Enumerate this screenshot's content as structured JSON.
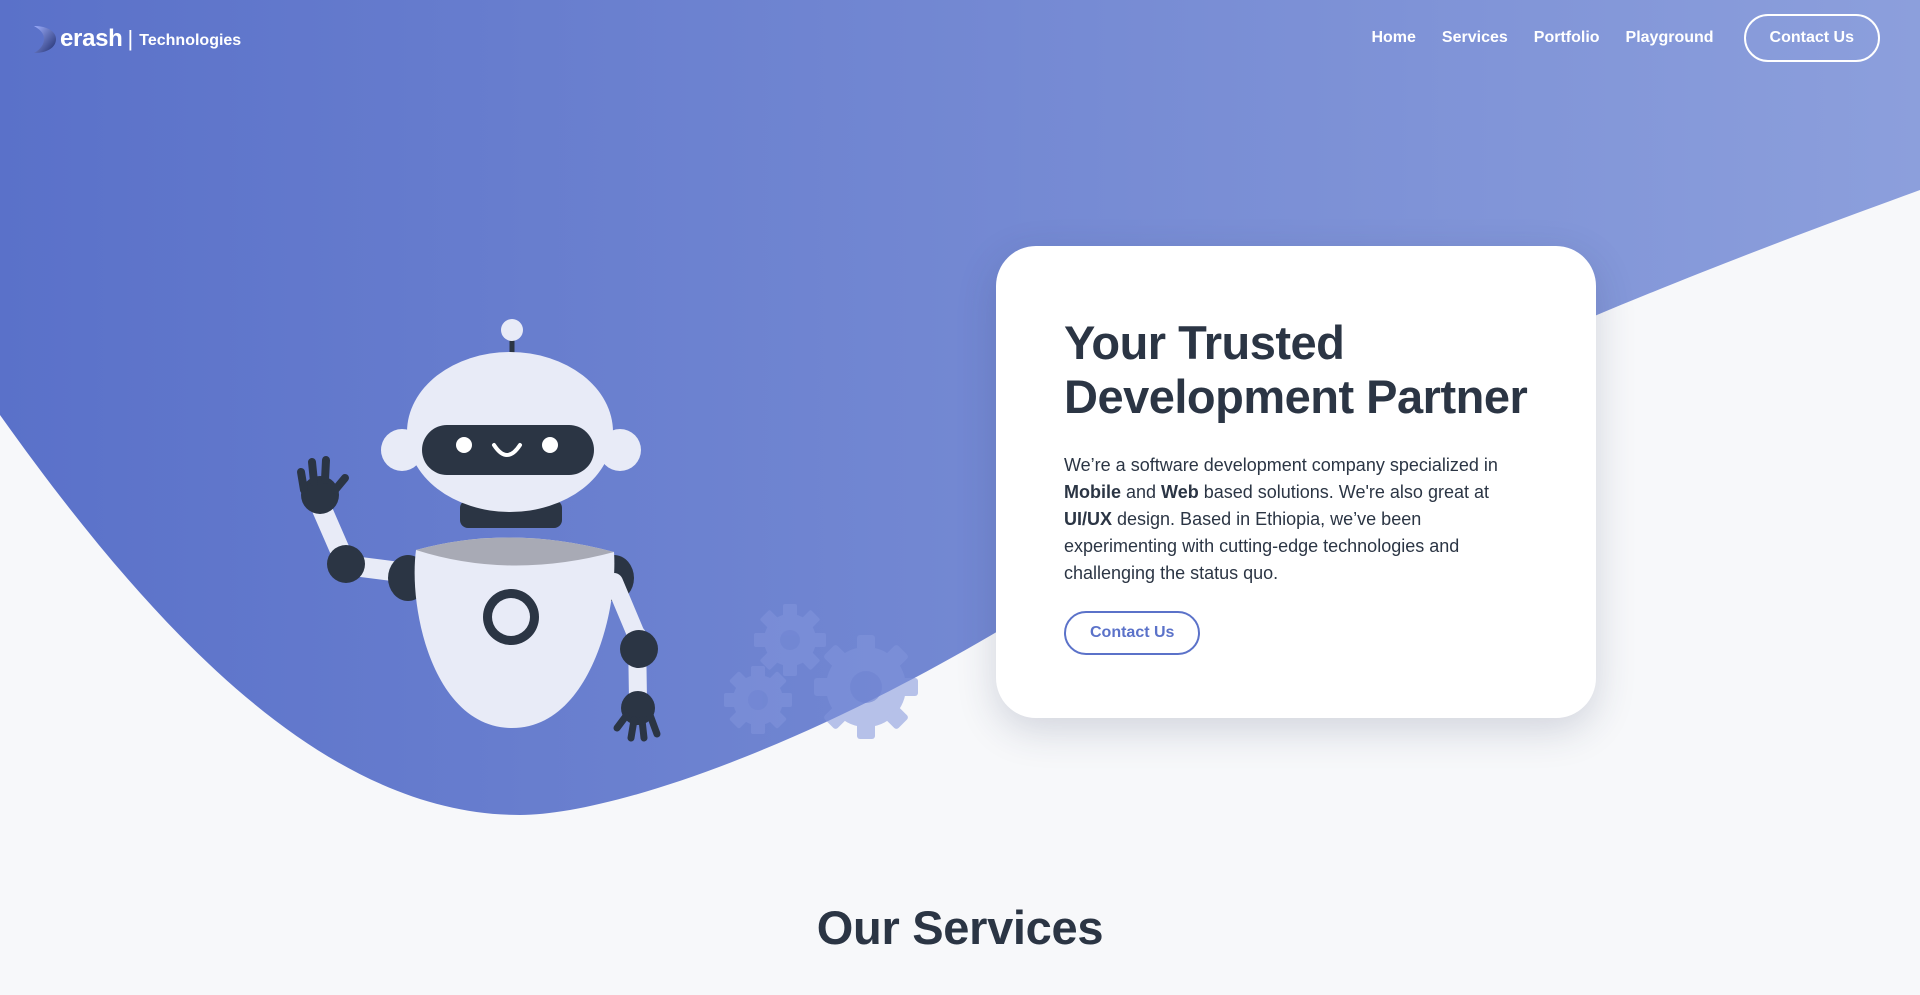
{
  "brand": {
    "name": "erash",
    "separator": "|",
    "tagline": "Technologies"
  },
  "nav": {
    "items": [
      {
        "label": "Home"
      },
      {
        "label": "Services"
      },
      {
        "label": "Portfolio"
      },
      {
        "label": "Playground"
      }
    ],
    "cta_label": "Contact Us"
  },
  "hero": {
    "title_line1": "Your Trusted",
    "title_line2": "Development Partner",
    "text": {
      "part1": "We’re a software development company specialized in ",
      "mobile": "Mobile",
      "and": " and ",
      "web": "Web",
      "part2": " based solutions. We're also great at ",
      "uiux": "UI/UX",
      "part3": " design. Based in Ethiopia, we’ve been experimenting with cutting-edge technologies and challenging the status quo."
    },
    "button_label": "Contact Us"
  },
  "services": {
    "title": "Our Services"
  },
  "colors": {
    "gradient_start": "#5b72c9",
    "gradient_end": "#8b9ddb",
    "text_dark": "#2b3544",
    "robot_light": "#e8ebf7",
    "robot_dark": "#2b3544",
    "page_bg": "#f7f8fa"
  }
}
